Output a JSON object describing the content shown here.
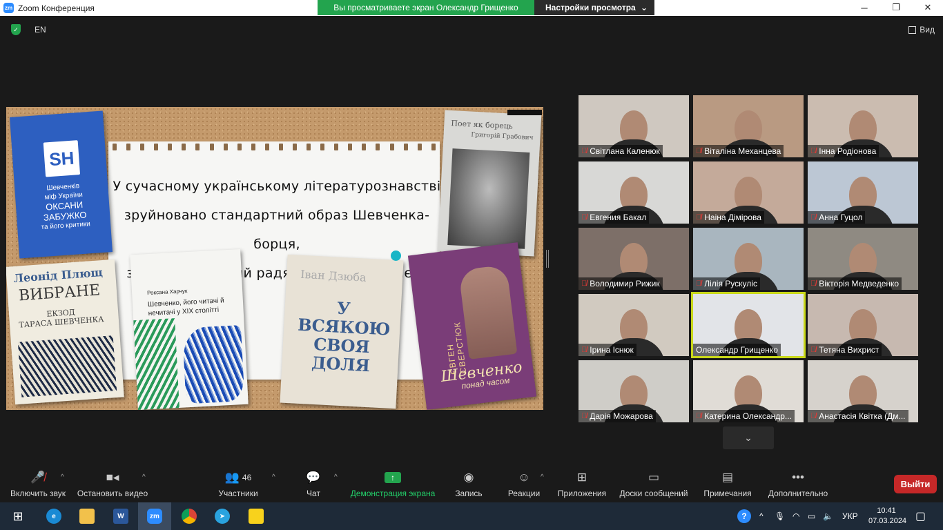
{
  "window": {
    "logo_text": "zm",
    "title": "Zoom Конференция",
    "share_banner": "Вы просматриваете экран Олександр Грищенко",
    "view_options": "Настройки просмотра"
  },
  "topbar": {
    "language": "EN",
    "view_label": "Вид"
  },
  "slide": {
    "quote_lines": [
      "У сучасному українському літературознавстві",
      "зруйновано стандартний образ Шевченка-борця,",
      "запрограмований радянською ідеологією."
    ],
    "book1": {
      "logo": "SH",
      "line1": "Шевченків",
      "line2": "міф України",
      "line3": "ОКСАНИ",
      "line4": "ЗАБУЖКО",
      "line5": "та його критики"
    },
    "book2": {
      "title": "Поет як борець",
      "author": "Григорій Грабович"
    },
    "book3": {
      "author": "Леонід Плющ",
      "title": "ВИБРАНЕ",
      "sub1": "ЕКЗОД",
      "sub2": "ТАРАСА ШЕВЧЕНКА"
    },
    "book4": {
      "author": "Роксана Харчук",
      "title": "Шевченко, його читачі й нечитачі у XIX столітті"
    },
    "book5": {
      "author": "Іван Дзюба",
      "title": "У ВСЯКОЮ СВОЯ ДОЛЯ"
    },
    "book6": {
      "author": "ЄВГЕН СВЕРСТЮК",
      "title": "Шевченко",
      "sub": "понад часом"
    }
  },
  "participants": [
    {
      "name": "Світлана Каленюк",
      "muted": true
    },
    {
      "name": "Віталіна Механцева",
      "muted": true
    },
    {
      "name": "Інна Родіонова",
      "muted": true
    },
    {
      "name": "Евгения Бакал",
      "muted": true
    },
    {
      "name": "Наіна Дімірова",
      "muted": true
    },
    {
      "name": "Анна Гуцол",
      "muted": true
    },
    {
      "name": "Володимир Рижик",
      "muted": true
    },
    {
      "name": "Лілія Рускуліс",
      "muted": true
    },
    {
      "name": "Вікторія Медведенко",
      "muted": true
    },
    {
      "name": "Ірина Існюк",
      "muted": true
    },
    {
      "name": "Олександр Грищенко",
      "muted": false,
      "active": true
    },
    {
      "name": "Тетяна Вихрист",
      "muted": true
    },
    {
      "name": "Дарія Можарова",
      "muted": true
    },
    {
      "name": "Катерина Олександр...",
      "muted": true
    },
    {
      "name": "Анастасія Квітка (Дм...",
      "muted": true
    }
  ],
  "toolbar": {
    "mute": "Включить звук",
    "video": "Остановить видео",
    "participants": "Участники",
    "participants_count": "46",
    "chat": "Чат",
    "share": "Демонстрация экрана",
    "record": "Запись",
    "reactions": "Реакции",
    "apps": "Приложения",
    "whiteboards": "Доски сообщений",
    "notes": "Примечания",
    "more": "Дополнительно",
    "leave": "Выйти"
  },
  "taskbar": {
    "language": "УКР",
    "time": "10:41",
    "date": "07.03.2024"
  },
  "colors": {
    "share_green": "#23a44e",
    "leave_red": "#c62828",
    "active_speaker": "#c9d81a"
  }
}
